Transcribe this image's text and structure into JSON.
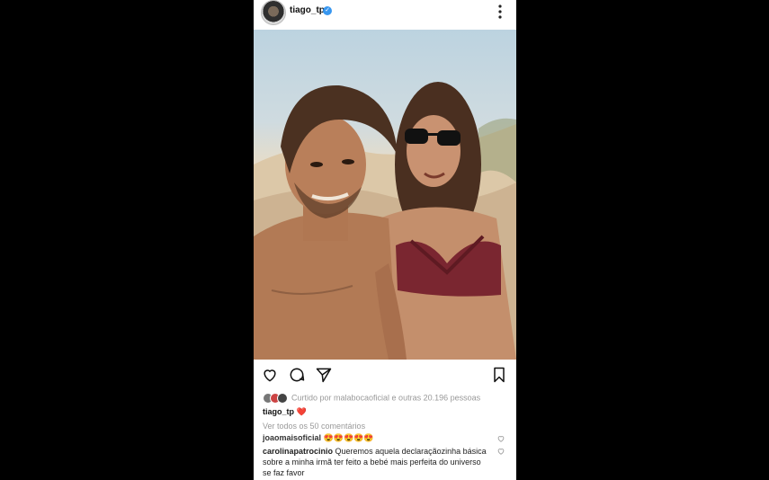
{
  "header": {
    "username": "tiago_tp"
  },
  "post": {
    "likes_text": "Curtido por malabocaoficial e outras 20.196 pessoas",
    "caption_user": "tiago_tp",
    "caption_text": "❤️",
    "view_all": "Ver todos os 50 comentários"
  },
  "comments": [
    {
      "user": "joaomaisoficial",
      "text": "😍😍😍😍😍"
    },
    {
      "user": "carolinapatrocinio",
      "text": "Queremos aquela declaraçãozinha básica sobre a minha irmã ter feito a bebé mais perfeita do universo se faz favor"
    }
  ],
  "colors": {
    "verified": "#3897f0",
    "heart": "#d21c2b",
    "muted": "#999999"
  }
}
